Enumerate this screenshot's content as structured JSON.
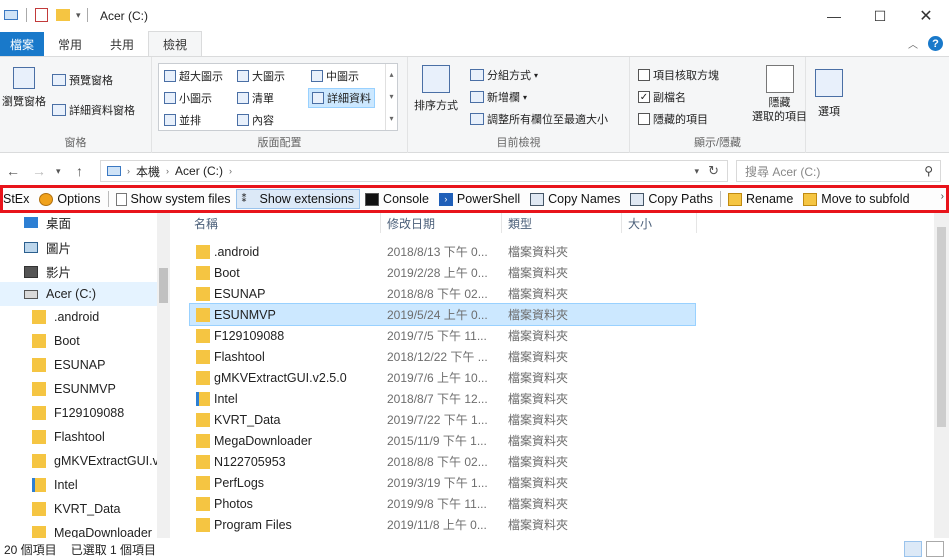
{
  "window": {
    "title": "Acer (C:)",
    "controls": [
      "minimize",
      "maximize",
      "close"
    ]
  },
  "ribbon_tabs": [
    "檔案",
    "常用",
    "共用",
    "檢視"
  ],
  "ribbon": {
    "panes_group": {
      "label": "窗格",
      "nav_pane": "瀏覽窗格",
      "preview_pane": "預覽窗格",
      "details_pane": "詳細資料窗格"
    },
    "layout_group": {
      "label": "版面配置",
      "options": [
        "超大圖示",
        "大圖示",
        "中圖示",
        "小圖示",
        "清單",
        "詳細資料",
        "並排",
        "內容"
      ],
      "selected": "詳細資料"
    },
    "current_view_group": {
      "label": "目前檢視",
      "sort_by": "排序方式",
      "group_by": "分組方式",
      "add_columns": "新增欄",
      "size_columns": "調整所有欄位至最適大小"
    },
    "show_hide_group": {
      "label": "顯示/隱藏",
      "item_checkboxes": {
        "label": "項目核取方塊",
        "checked": false
      },
      "file_extensions": {
        "label": "副檔名",
        "checked": true
      },
      "hidden_items": {
        "label": "隱藏的項目",
        "checked": false
      },
      "hide_selected_line1": "隱藏",
      "hide_selected_line2": "選取的項目"
    },
    "options_label": "選項"
  },
  "address": {
    "path": [
      "本機",
      "Acer (C:)"
    ],
    "search_placeholder": "搜尋 Acer (C:)"
  },
  "stexbar": {
    "items": [
      {
        "label": "StEx"
      },
      {
        "label": "Options"
      },
      {
        "label": "Show system files"
      },
      {
        "label": "Show extensions",
        "active": true
      },
      {
        "label": "Console"
      },
      {
        "label": "PowerShell"
      },
      {
        "label": "Copy Names"
      },
      {
        "label": "Copy Paths"
      },
      {
        "label": "Rename"
      },
      {
        "label": "Move to subfold"
      }
    ]
  },
  "nav_pane": {
    "items": [
      {
        "label": "桌面",
        "indent": 1
      },
      {
        "label": "圖片",
        "indent": 1
      },
      {
        "label": "影片",
        "indent": 1
      },
      {
        "label": "Acer (C:)",
        "indent": 1,
        "selected": true
      },
      {
        "label": ".android",
        "indent": 2
      },
      {
        "label": "Boot",
        "indent": 2
      },
      {
        "label": "ESUNAP",
        "indent": 2
      },
      {
        "label": "ESUNMVP",
        "indent": 2
      },
      {
        "label": "F129109088",
        "indent": 2
      },
      {
        "label": "Flashtool",
        "indent": 2
      },
      {
        "label": "gMKVExtractGUI.v",
        "indent": 2
      },
      {
        "label": "Intel",
        "indent": 2
      },
      {
        "label": "KVRT_Data",
        "indent": 2
      },
      {
        "label": "MegaDownloader",
        "indent": 2
      }
    ]
  },
  "file_list": {
    "columns": [
      "名稱",
      "修改日期",
      "類型",
      "大小"
    ],
    "rows": [
      {
        "name": ".android",
        "date": "2018/8/13 下午 0...",
        "type": "檔案資料夾"
      },
      {
        "name": "Boot",
        "date": "2019/2/28 上午 0...",
        "type": "檔案資料夾"
      },
      {
        "name": "ESUNAP",
        "date": "2018/8/8 下午 02...",
        "type": "檔案資料夾"
      },
      {
        "name": "ESUNMVP",
        "date": "2019/5/24 上午 0...",
        "type": "檔案資料夾",
        "selected": true
      },
      {
        "name": "F129109088",
        "date": "2019/7/5 下午 11...",
        "type": "檔案資料夾"
      },
      {
        "name": "Flashtool",
        "date": "2018/12/22 下午 ...",
        "type": "檔案資料夾"
      },
      {
        "name": "gMKVExtractGUI.v2.5.0",
        "date": "2019/7/6 上午 10...",
        "type": "檔案資料夾"
      },
      {
        "name": "Intel",
        "date": "2018/8/7 下午 12...",
        "type": "檔案資料夾"
      },
      {
        "name": "KVRT_Data",
        "date": "2019/7/22 下午 1...",
        "type": "檔案資料夾"
      },
      {
        "name": "MegaDownloader",
        "date": "2015/11/9 下午 1...",
        "type": "檔案資料夾"
      },
      {
        "name": "N122705953",
        "date": "2018/8/8 下午 02...",
        "type": "檔案資料夾"
      },
      {
        "name": "PerfLogs",
        "date": "2019/3/19 下午 1...",
        "type": "檔案資料夾"
      },
      {
        "name": "Photos",
        "date": "2019/9/8 下午 11...",
        "type": "檔案資料夾"
      },
      {
        "name": "Program Files",
        "date": "2019/11/8 上午 0...",
        "type": "檔案資料夾"
      }
    ]
  },
  "status_bar": {
    "item_count": "20 個項目",
    "selected_count": "已選取 1 個項目"
  },
  "colors": {
    "accent": "#1979ca",
    "highlight": "#e8141b",
    "selection": "#cce8ff"
  }
}
